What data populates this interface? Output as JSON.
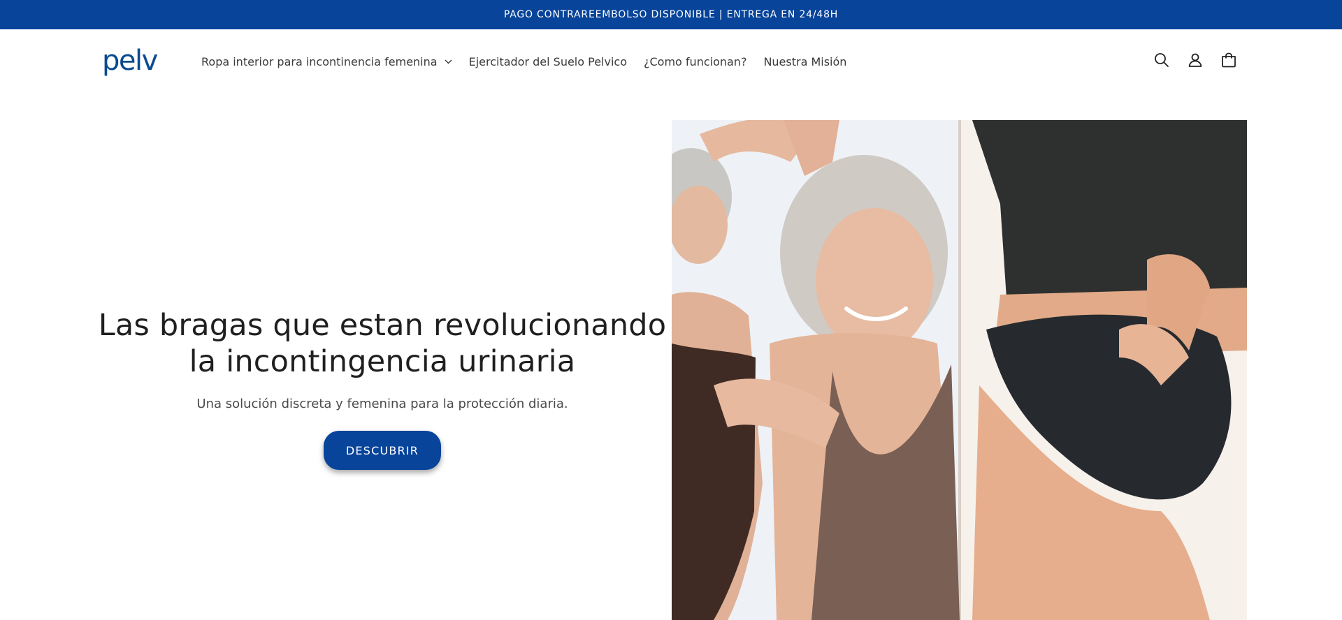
{
  "announcement": {
    "text": "PAGO CONTRAREEMBOLSO DISPONIBLE | ENTREGA EN 24/48H"
  },
  "header": {
    "logo_text": "pelv",
    "nav": [
      {
        "label": "Ropa interior para incontinencia femenina",
        "has_dropdown": true
      },
      {
        "label": "Ejercitador del Suelo Pelvico"
      },
      {
        "label": "¿Como funcionan?"
      },
      {
        "label": "Nuestra Misión"
      }
    ],
    "icons": [
      "search-icon",
      "account-icon",
      "cart-icon"
    ]
  },
  "hero": {
    "title_line1": "Las bragas que estan revolucionando",
    "title_line2": "la incontingencia urinaria",
    "subtitle": "Una solución discreta y femenina para la protección diaria.",
    "button_label": "DESCUBRIR"
  },
  "colors": {
    "brand_blue": "#07449a",
    "logo_blue": "#0a4a8f",
    "text": "#1f1f1f"
  }
}
